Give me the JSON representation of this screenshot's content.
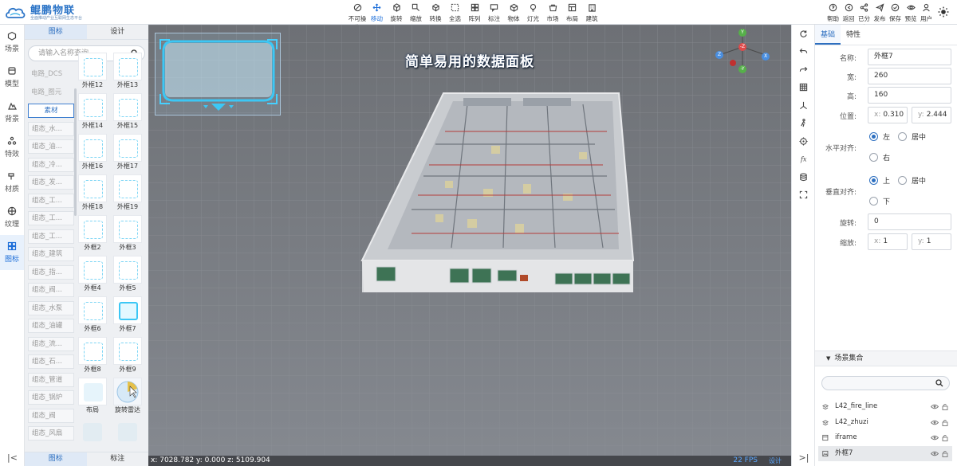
{
  "app": {
    "brand": "鲲鹏物联",
    "tagline": "全面推动产业互联网生态平台"
  },
  "toolbar": [
    {
      "label": "不可操作",
      "icon": "forbidden-icon"
    },
    {
      "label": "移动",
      "icon": "move-icon",
      "active": true
    },
    {
      "label": "旋转",
      "icon": "rotate-icon"
    },
    {
      "label": "缩放",
      "icon": "scale-icon"
    },
    {
      "label": "转换",
      "icon": "transform-icon"
    },
    {
      "label": "全选",
      "icon": "select-all-icon"
    },
    {
      "label": "阵列",
      "icon": "array-icon"
    },
    {
      "label": "标注",
      "icon": "annotate-icon"
    },
    {
      "label": "物体",
      "icon": "object-icon"
    },
    {
      "label": "灯光",
      "icon": "light-icon"
    },
    {
      "label": "市场",
      "icon": "market-icon"
    },
    {
      "label": "布局",
      "icon": "layout-icon"
    },
    {
      "label": "建筑",
      "icon": "building-icon"
    }
  ],
  "right_toolbar": [
    {
      "label": "帮助",
      "icon": "help-icon"
    },
    {
      "label": "返回",
      "icon": "back-icon"
    },
    {
      "label": "已分享",
      "icon": "share-icon"
    },
    {
      "label": "发布",
      "icon": "publish-icon"
    },
    {
      "label": "保存",
      "icon": "save-icon"
    },
    {
      "label": "预览",
      "icon": "preview-icon"
    },
    {
      "label": "用户",
      "icon": "user-icon"
    },
    {
      "label": "",
      "icon": "theme-sun-icon"
    }
  ],
  "left_nav": [
    {
      "label": "场景",
      "icon": "scene-icon"
    },
    {
      "label": "模型",
      "icon": "model-icon"
    },
    {
      "label": "背景",
      "icon": "background-icon"
    },
    {
      "label": "特效",
      "icon": "effects-icon"
    },
    {
      "label": "材质",
      "icon": "material-icon"
    },
    {
      "label": "纹理",
      "icon": "texture-icon"
    },
    {
      "label": "图标",
      "icon": "icons-icon",
      "active": true
    }
  ],
  "left_panel": {
    "tabs": [
      "图标",
      "设计"
    ],
    "search_placeholder": "请输入名称查询",
    "categories": [
      "电路_DCS",
      "电路_图元",
      "素材",
      "组态_水...",
      "组态_油...",
      "组态_冷...",
      "组态_发...",
      "组态_工...",
      "组态_工...",
      "组态_工...",
      "组态_建筑",
      "组态_指...",
      "组态_阀...",
      "组态_水泵",
      "组态_油罐",
      "组态_流...",
      "组态_石...",
      "组态_管道",
      "组态_锅炉",
      "组态_阀",
      "组态_风扇"
    ],
    "tiles": [
      "外框12",
      "外框13",
      "外框14",
      "外框15",
      "外框16",
      "外框17",
      "外框18",
      "外框19",
      "外框2",
      "外框3",
      "外框4",
      "外框5",
      "外框6",
      "外框7",
      "外框8",
      "外框9",
      "布局",
      "旋转雷达",
      "",
      ""
    ],
    "footer_tabs": [
      "图标",
      "标注"
    ]
  },
  "viewport": {
    "title": "简单易用的数据面板",
    "status": "x: 7028.782 y: 0.000 z: 5109.904",
    "fps": "22 FPS",
    "mode": "设计",
    "gizmo_labels": [
      "Y",
      "Z",
      "-Z",
      "X",
      "-Y"
    ]
  },
  "right_tools": [
    "refresh-icon",
    "undo-icon",
    "redo-icon",
    "grid-icon",
    "axis-icon",
    "walk-icon",
    "target-icon",
    "function-icon",
    "database-icon",
    "fullscreen-icon"
  ],
  "props": {
    "tabs": [
      "基础",
      "特性"
    ],
    "name_label": "名称:",
    "name": "外框7",
    "width_label": "宽:",
    "width": "260",
    "height_label": "高:",
    "height": "160",
    "pos_label": "位置:",
    "pos_x_prefix": "x:",
    "pos_x": "0.310",
    "pos_y_prefix": "y:",
    "pos_y": "2.444",
    "halign_label": "水平对齐:",
    "halign_options": [
      "左",
      "居中",
      "右"
    ],
    "halign_selected": "左",
    "valign_label": "垂直对齐:",
    "valign_options": [
      "上",
      "居中",
      "下"
    ],
    "valign_selected": "上",
    "rotate_label": "旋转:",
    "rotate": "0",
    "scale_label": "缩放:",
    "scale_x_prefix": "x:",
    "scale_x": "1",
    "scale_y_prefix": "y:",
    "scale_y": "1"
  },
  "scene_collection": {
    "title": "场景集合",
    "items": [
      {
        "name": "L42_fire_line",
        "icon": "layer-icon"
      },
      {
        "name": "L42_zhuzi",
        "icon": "layer-icon"
      },
      {
        "name": "iframe",
        "icon": "iframe-icon"
      },
      {
        "name": "外框7",
        "icon": "image-icon",
        "selected": true
      }
    ]
  },
  "colors": {
    "accent": "#2d6fc0",
    "viewport_bg": "#7b7e84",
    "frame_cyan": "#3cc7f5"
  }
}
